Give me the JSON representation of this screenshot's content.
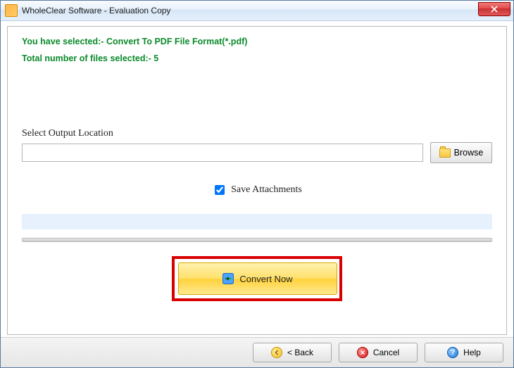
{
  "window": {
    "title": "WholeClear Software - Evaluation Copy"
  },
  "info": {
    "line1": "You have selected:- Convert To PDF File Format(*.pdf)",
    "line2": "Total number of files selected:- 5"
  },
  "output": {
    "label": "Select Output Location",
    "path_value": "",
    "browse_label": "Browse"
  },
  "options": {
    "save_attachments_label": "Save Attachments",
    "save_attachments_checked": true
  },
  "actions": {
    "convert_label": "Convert Now"
  },
  "nav": {
    "back_label": "< Back",
    "cancel_label": "Cancel",
    "help_label": "Help"
  }
}
